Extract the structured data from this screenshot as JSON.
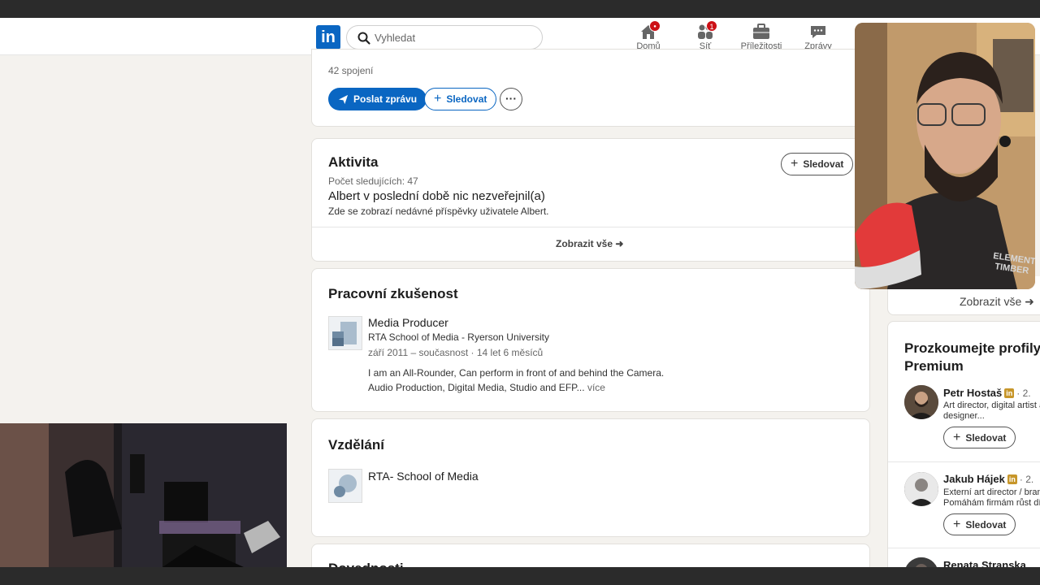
{
  "navbar": {
    "logo": "in",
    "search_placeholder": "Vyhledat",
    "items": [
      {
        "label": "Domů",
        "icon": "home-icon",
        "badge": "●"
      },
      {
        "label": "Síť",
        "icon": "network-icon",
        "badge": "1"
      },
      {
        "label": "Příležitosti",
        "icon": "briefcase-icon",
        "badge": ""
      },
      {
        "label": "Zprávy",
        "icon": "messaging-icon",
        "badge": ""
      }
    ]
  },
  "profile": {
    "connections": "42 spojení",
    "message_label": "Poslat zprávu",
    "follow_label": "Sledovat",
    "more_label": "···"
  },
  "activity": {
    "title": "Aktivita",
    "followers": "Počet sledujících: 47",
    "follow_label": "Sledovat",
    "empty_title": "Albert v poslední době nic nezveřejnil(a)",
    "empty_desc": "Zde se zobrazí nedávné příspěvky uživatele Albert.",
    "show_all": "Zobrazit vše"
  },
  "experience": {
    "title": "Pracovní zkušenost",
    "role": "Media Producer",
    "company": "RTA School of Media - Ryerson University",
    "dates": "září 2011 – současnost · 14 let 6 měsíců",
    "desc_line1": "I am an All-Rounder, Can perform in front of and behind the Camera.",
    "desc_line2": "Audio Production, Digital Media, Studio and EFP...",
    "more": "více"
  },
  "education": {
    "title": "Vzdělání",
    "school": "RTA- School of Media"
  },
  "next_section": {
    "title": "Dovednosti"
  },
  "sidebar": {
    "show_all": "Zobrazit vše",
    "title": "Prozkoumejte profily Premium",
    "people": [
      {
        "name": "Petr Hostaš",
        "degree": "· 2.",
        "headline1": "Art director, digital artist a",
        "headline2": "designer...",
        "follow": "Sledovat"
      },
      {
        "name": "Jakub Hájek",
        "degree": "· 2.",
        "headline1": "Externí art director / brand",
        "headline2": "Pomáhám firmám růst dík",
        "follow": "Sledovat"
      },
      {
        "name": "Renata Stranska",
        "degree": "",
        "headline1": "",
        "headline2": "",
        "follow": ""
      }
    ],
    "in_badge": "in"
  },
  "webcam": {
    "shirt_text1": "ELEMENT",
    "shirt_text2": "TIMBER"
  },
  "colors": {
    "brand": "#0a66c2",
    "notification": "#cc1016",
    "premium": "#c7962a"
  }
}
